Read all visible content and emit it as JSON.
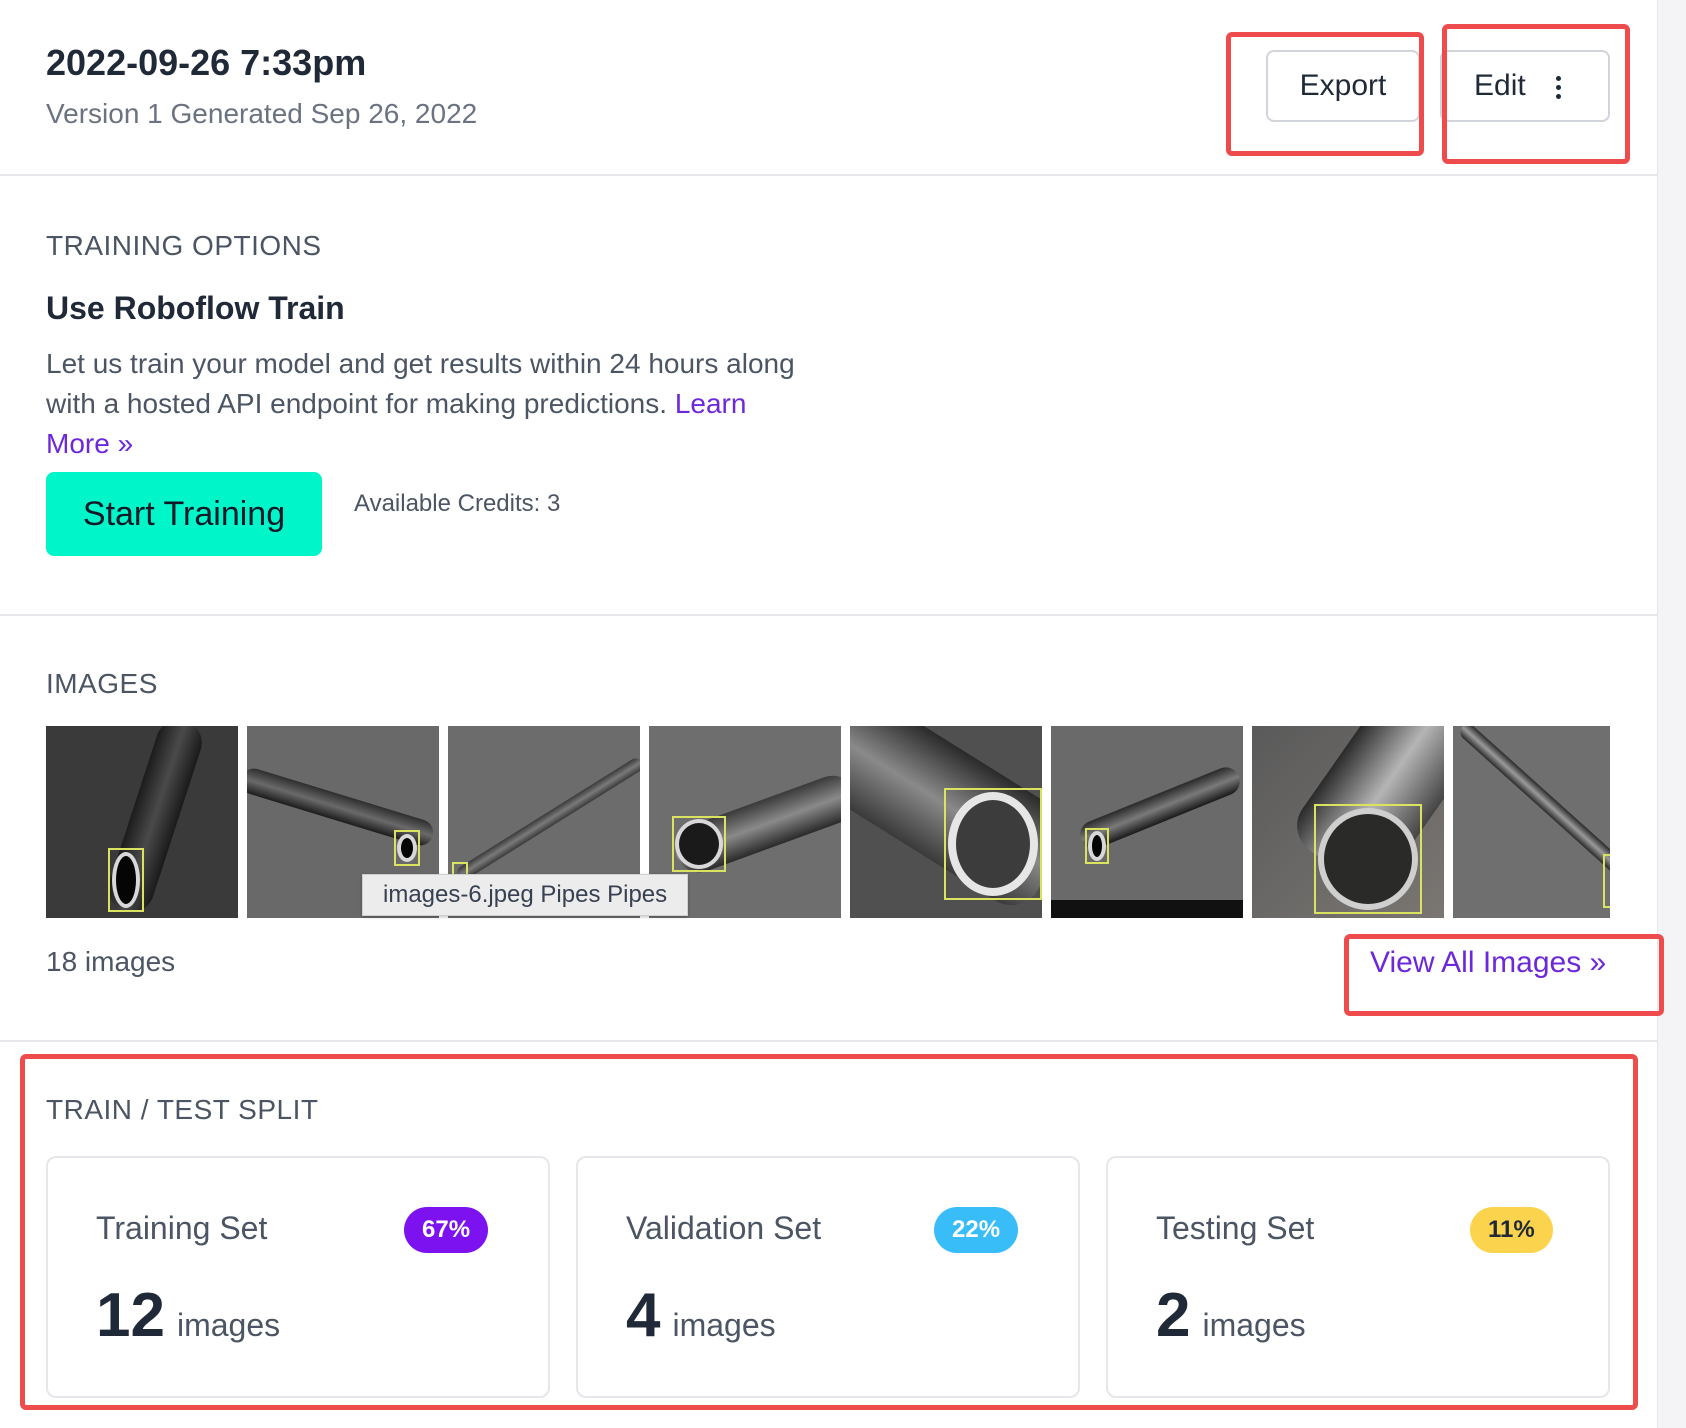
{
  "header": {
    "title": "2022-09-26 7:33pm",
    "subtitle": "Version 1 Generated Sep 26, 2022",
    "export_label": "Export",
    "edit_label": "Edit"
  },
  "training": {
    "section_label": "TRAINING OPTIONS",
    "heading": "Use Roboflow Train",
    "description": "Let us train your model and get results within 24 hours along with a hosted API endpoint for making predictions.",
    "learn_more": "Learn More »",
    "start_button": "Start Training",
    "credits": "Available Credits: 3"
  },
  "images": {
    "section_label": "IMAGES",
    "tooltip": "images-6.jpeg Pipes Pipes",
    "count_label": "18 images",
    "view_all": "View All Images »"
  },
  "split": {
    "section_label": "TRAIN / TEST SPLIT",
    "sets": [
      {
        "label": "Training Set",
        "percent": "67%",
        "count": "12",
        "unit": "images",
        "badge_color": "#7c12f0",
        "badge_text_color": "#ffffff"
      },
      {
        "label": "Validation Set",
        "percent": "22%",
        "count": "4",
        "unit": "images",
        "badge_color": "#38bdf8",
        "badge_text_color": "#ffffff"
      },
      {
        "label": "Testing Set",
        "percent": "11%",
        "count": "2",
        "unit": "images",
        "badge_color": "#fcd34d",
        "badge_text_color": "#1f2937"
      }
    ]
  },
  "colors": {
    "accent_purple": "#6d28d9",
    "start_button": "#00f5c9",
    "highlight_red": "#ee4c4c"
  }
}
